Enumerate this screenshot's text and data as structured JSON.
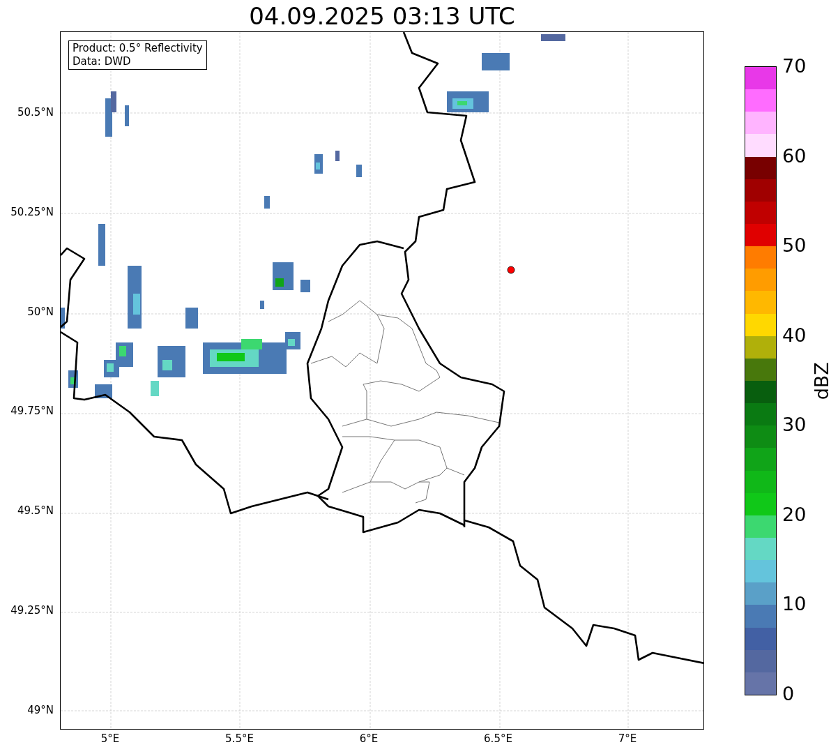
{
  "title": "04.09.2025 03:13 UTC",
  "map": {
    "legend": [
      "Product: 0.5° Reflectivity",
      "Data: DWD"
    ],
    "xticks": [
      "5°E",
      "5.5°E",
      "6°E",
      "6.5°E",
      "7°E"
    ],
    "yticks": [
      "50.5°N",
      "50.25°N",
      "50°N",
      "49.75°N",
      "49.5°N",
      "49.25°N",
      "49°N"
    ]
  },
  "colorbar": {
    "label": "dBZ",
    "ticks": [
      "70",
      "60",
      "50",
      "40",
      "30",
      "20",
      "10",
      "0"
    ],
    "bins": [
      {
        "color": "#6674a8"
      },
      {
        "color": "#5468a0"
      },
      {
        "color": "#4260a4"
      },
      {
        "color": "#4a7ab4"
      },
      {
        "color": "#5aa0c8"
      },
      {
        "color": "#64c4dc"
      },
      {
        "color": "#64d8c4"
      },
      {
        "color": "#3cd870"
      },
      {
        "color": "#10c818"
      },
      {
        "color": "#10b818"
      },
      {
        "color": "#10a418"
      },
      {
        "color": "#0e8c14"
      },
      {
        "color": "#0a7a12"
      },
      {
        "color": "#085e0e"
      },
      {
        "color": "#48780c"
      },
      {
        "color": "#b0b00a"
      },
      {
        "color": "#ffd800"
      },
      {
        "color": "#ffb800"
      },
      {
        "color": "#ff9c00"
      },
      {
        "color": "#ff7c00"
      },
      {
        "color": "#e00000"
      },
      {
        "color": "#c00000"
      },
      {
        "color": "#a00000"
      },
      {
        "color": "#780000"
      },
      {
        "color": "#ffdcff"
      },
      {
        "color": "#ffb4ff"
      },
      {
        "color": "#ff6cff"
      },
      {
        "color": "#e838e8"
      }
    ]
  }
}
